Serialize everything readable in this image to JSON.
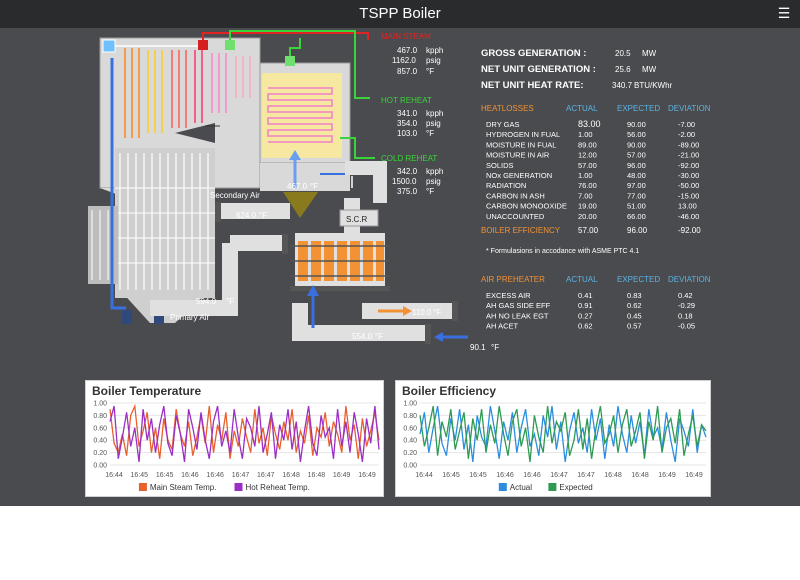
{
  "app": {
    "title": "TSPP Boiler",
    "menu_icon": "hamburger-icon"
  },
  "process": {
    "main_steam": {
      "label": "MAIN STEAM",
      "flow": "467.0",
      "flow_unit": "kpph",
      "pressure": "1162.0",
      "pressure_unit": "psig",
      "temp": "857.0",
      "temp_unit": "°F"
    },
    "hot_reheat": {
      "label": "HOT REHEAT",
      "flow": "341.0",
      "flow_unit": "kpph",
      "pressure": "354.0",
      "pressure_unit": "psig",
      "temp": "103.0",
      "temp_unit": "°F"
    },
    "cold_reheat": {
      "label": "COLD REHEAT",
      "flow": "342.0",
      "flow_unit": "kpph",
      "pressure": "1500.0",
      "pressure_unit": "psig",
      "temp": "375.0",
      "temp_unit": "°F"
    },
    "economizer_temp": "467.0",
    "economizer_unit": "°F",
    "secondary_air_label": "Secondary Air",
    "secondary_air_temp": "624.0",
    "secondary_air_unit": "°F",
    "scr_label": "S.C.R",
    "primary_air_label": "Primary Air",
    "primary_air_temp": "594.0",
    "primary_air_unit": "°F",
    "ah_outlet_temp": "110.0",
    "ah_outlet_unit": "°F",
    "duct_temp": "554.0",
    "duct_unit": "°F",
    "ambient_temp": "90.1",
    "ambient_unit": "°F"
  },
  "summary": [
    {
      "label": "GROSS GENERATION :",
      "value": "20.5",
      "unit": "MW"
    },
    {
      "label": "NET UNIT GENERATION :",
      "value": "25.6",
      "unit": "MW"
    },
    {
      "label": "NET UNIT HEAT RATE:",
      "value": "340.7",
      "unit": "BTU/KWhr"
    }
  ],
  "heatlosses": {
    "title": "HEATLOSSES",
    "columns": [
      "ACTUAL",
      "EXPECTED",
      "DEVIATION"
    ],
    "rows": [
      {
        "name": "DRY GAS",
        "actual": "83.00",
        "expected": "90.00",
        "deviation": "-7.00"
      },
      {
        "name": "HYDROGEN IN FUAL",
        "actual": "1.00",
        "expected": "56.00",
        "deviation": "-2.00"
      },
      {
        "name": "MOISTURE IN FUAL",
        "actual": "89.00",
        "expected": "90.00",
        "deviation": "-89.00"
      },
      {
        "name": "MOISTURE IN AIR",
        "actual": "12.00",
        "expected": "57.00",
        "deviation": "-21.00"
      },
      {
        "name": "SOLIDS",
        "actual": "57.00",
        "expected": "96.00",
        "deviation": "-92.00"
      },
      {
        "name": "NOx GENERATION",
        "actual": "1.00",
        "expected": "48.00",
        "deviation": "-30.00"
      },
      {
        "name": "RADIATION",
        "actual": "76.00",
        "expected": "97.00",
        "deviation": "-50.00"
      },
      {
        "name": "CARBON IN ASH",
        "actual": "7.00",
        "expected": "77.00",
        "deviation": "-15.00"
      },
      {
        "name": "CARBON MONOOXIDE",
        "actual": "19.00",
        "expected": "51.00",
        "deviation": "13.00"
      },
      {
        "name": "UNACCOUNTED",
        "actual": "20.00",
        "expected": "66.00",
        "deviation": "-46.00"
      }
    ],
    "efficiency": {
      "name": "BOILER EFFICIENCY",
      "actual": "57.00",
      "expected": "96.00",
      "deviation": "-92.00"
    },
    "note": "* Formulasions in accodance with ASME PTC 4.1"
  },
  "air_preheater": {
    "title": "AIR PREHEATER",
    "columns": [
      "ACTUAL",
      "EXPECTED",
      "DEVIATION"
    ],
    "rows": [
      {
        "name": "EXCESS AIR",
        "actual": "0.41",
        "expected": "0.83",
        "deviation": "0.42"
      },
      {
        "name": "AH GAS SIDE EFF",
        "actual": "0.91",
        "expected": "0.62",
        "deviation": "-0.29"
      },
      {
        "name": "AH NO LEAK EGT",
        "actual": "0.27",
        "expected": "0.45",
        "deviation": "0.18"
      },
      {
        "name": "AH ACET",
        "actual": "0.62",
        "expected": "0.57",
        "deviation": "-0.05"
      }
    ]
  },
  "chart_data": [
    {
      "type": "line",
      "title": "Boiler Temperature",
      "x": [
        "16:44",
        "16:45",
        "16:45",
        "16:46",
        "16:46",
        "16:47",
        "16:47",
        "16:48",
        "16:48",
        "16:49",
        "16:49"
      ],
      "ylim": [
        0,
        1
      ],
      "yticks": [
        "0.00",
        "0.20",
        "0.40",
        "0.60",
        "0.80",
        "1.00"
      ],
      "series": [
        {
          "name": "Main Steam Temp.",
          "color": "#e8602c",
          "values": [
            0.9,
            0.35,
            0.2,
            0.5,
            0.15,
            0.8,
            0.95,
            0.3,
            0.55,
            0.85,
            0.2,
            0.6,
            0.1,
            0.75,
            0.4,
            0.25,
            0.9,
            0.5,
            0.3,
            0.7,
            0.15,
            0.45,
            0.8,
            0.35,
            0.95,
            0.2,
            0.65,
            0.4,
            0.85,
            0.1,
            0.55,
            0.3,
            0.75,
            0.45,
            0.2,
            0.9,
            0.35,
            0.6,
            0.15,
            0.8,
            0.5,
            0.25,
            0.7,
            0.4,
            0.9,
            0.2,
            0.55,
            0.35,
            0.8,
            0.15,
            0.6,
            0.45,
            0.85,
            0.3,
            0.7,
            0.5,
            0.2,
            0.95,
            0.4,
            0.65,
            0.1,
            0.75,
            0.3,
            0.55,
            0.85,
            0.4
          ]
        },
        {
          "name": "Hot Reheat Temp.",
          "color": "#9b2fc4",
          "values": [
            0.7,
            0.95,
            0.1,
            0.45,
            0.85,
            0.3,
            0.6,
            0.05,
            0.9,
            0.4,
            0.75,
            0.2,
            0.65,
            0.95,
            0.35,
            0.15,
            0.8,
            0.5,
            0.05,
            0.9,
            0.6,
            0.25,
            0.85,
            0.4,
            0.1,
            0.7,
            0.95,
            0.3,
            0.55,
            0.2,
            0.9,
            0.45,
            0.1,
            0.75,
            0.6,
            0.3,
            0.95,
            0.2,
            0.5,
            0.85,
            0.1,
            0.65,
            0.4,
            0.9,
            0.25,
            0.7,
            0.05,
            0.55,
            0.95,
            0.35,
            0.15,
            0.8,
            0.45,
            0.6,
            0.1,
            0.9,
            0.3,
            0.7,
            0.2,
            0.85,
            0.5,
            0.05,
            0.75,
            0.35,
            0.95,
            0.25
          ]
        }
      ]
    },
    {
      "type": "line",
      "title": "Boiler Efficiency",
      "x": [
        "16:44",
        "16:45",
        "16:45",
        "16:46",
        "16:46",
        "16:47",
        "16:47",
        "16:48",
        "16:48",
        "16:49",
        "16:49"
      ],
      "ylim": [
        0,
        1
      ],
      "yticks": [
        "0.00",
        "0.20",
        "0.40",
        "0.60",
        "0.80",
        "1.00"
      ],
      "series": [
        {
          "name": "Actual",
          "color": "#2b8de0",
          "values": [
            0.5,
            0.85,
            0.2,
            0.6,
            0.95,
            0.35,
            0.15,
            0.75,
            0.4,
            0.9,
            0.25,
            0.65,
            0.05,
            0.8,
            0.45,
            0.3,
            0.95,
            0.55,
            0.1,
            0.7,
            0.4,
            0.85,
            0.2,
            0.6,
            0.9,
            0.3,
            0.5,
            0.15,
            0.8,
            0.45,
            0.95,
            0.25,
            0.7,
            0.05,
            0.55,
            0.85,
            0.35,
            0.6,
            0.2,
            0.9,
            0.4,
            0.75,
            0.1,
            0.65,
            0.3,
            0.95,
            0.5,
            0.2,
            0.8,
            0.35,
            0.7,
            0.15,
            0.9,
            0.45,
            0.6,
            0.25,
            0.85,
            0.4,
            0.05,
            0.75,
            0.55,
            0.3,
            0.9,
            0.2,
            0.65,
            0.45
          ]
        },
        {
          "name": "Expected",
          "color": "#2e9a52",
          "values": [
            0.8,
            0.3,
            0.6,
            0.95,
            0.15,
            0.7,
            0.45,
            0.9,
            0.25,
            0.55,
            0.85,
            0.1,
            0.75,
            0.4,
            0.9,
            0.2,
            0.65,
            0.35,
            0.95,
            0.5,
            0.15,
            0.7,
            0.9,
            0.3,
            0.6,
            0.05,
            0.8,
            0.45,
            0.2,
            0.95,
            0.35,
            0.7,
            0.55,
            0.85,
            0.15,
            0.4,
            0.9,
            0.25,
            0.75,
            0.1,
            0.6,
            0.95,
            0.35,
            0.5,
            0.8,
            0.2,
            0.65,
            0.9,
            0.3,
            0.55,
            0.85,
            0.1,
            0.7,
            0.4,
            0.95,
            0.2,
            0.6,
            0.75,
            0.35,
            0.9,
            0.15,
            0.5,
            0.8,
            0.3,
            0.65,
            0.55
          ]
        }
      ]
    }
  ],
  "colors": {
    "background": "#4a4b4e",
    "titlebar": "#2a2b2d",
    "orange": "#f39234",
    "blue": "#5ab4e6",
    "red": "#e02424",
    "green": "#39d439"
  }
}
